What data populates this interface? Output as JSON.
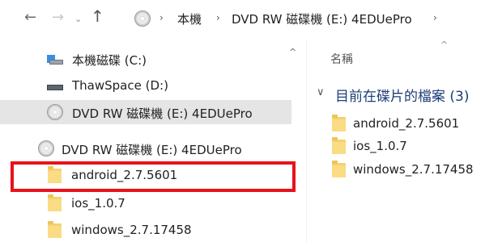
{
  "address_bar": {
    "back_icon": "arrow-left-icon",
    "forward_icon": "arrow-right-icon",
    "recent_icon": "chevron-down-icon",
    "up_icon": "arrow-up-icon",
    "back_glyph": "←",
    "forward_glyph": "→",
    "recent_glyph": "⌄",
    "up_glyph": "↑",
    "sep_glyph": "›",
    "breadcrumbs": [
      "本機",
      "DVD RW 磁碟機 (E:) 4EDUePro"
    ]
  },
  "nav_pane": {
    "scroll_up_glyph": "^",
    "items": [
      {
        "label": "本機磁碟 (C:)",
        "icon": "local-disk-icon"
      },
      {
        "label": "ThawSpace (D:)",
        "icon": "drive-icon"
      },
      {
        "label": "DVD RW 磁碟機 (E:) 4EDUePro",
        "icon": "dvd-drive-icon",
        "selected": true
      },
      {
        "label": "DVD RW 磁碟機 (E:) 4EDUePro",
        "icon": "dvd-drive-icon"
      },
      {
        "label": "android_2.7.5601",
        "icon": "folder-icon",
        "highlighted": true
      },
      {
        "label": "ios_1.0.7",
        "icon": "folder-icon"
      },
      {
        "label": "windows_2.7.17458",
        "icon": "folder-icon"
      }
    ],
    "highlight_color": "#e8121a"
  },
  "content_pane": {
    "sort_glyph": "^",
    "column_header": "名稱",
    "group_chevron_glyph": "∨",
    "group_title": "目前在碟片的檔案 (3)",
    "files": [
      {
        "name": "android_2.7.5601",
        "icon": "folder-icon"
      },
      {
        "name": "ios_1.0.7",
        "icon": "folder-icon"
      },
      {
        "name": "windows_2.7.17458",
        "icon": "folder-icon"
      }
    ]
  },
  "colors": {
    "selection": "#e5e5e5",
    "group_title": "#1e3c78",
    "folder": "#f9dc84"
  }
}
